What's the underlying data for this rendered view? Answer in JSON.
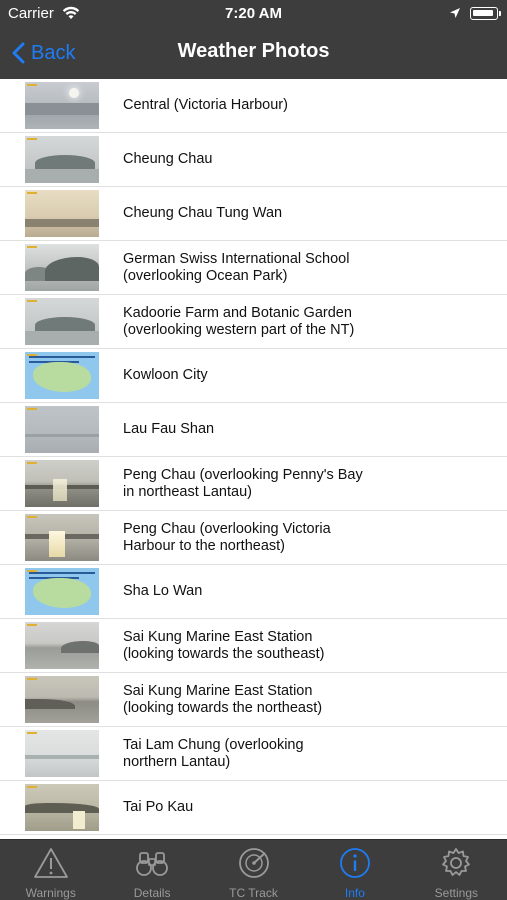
{
  "status_bar": {
    "carrier": "Carrier",
    "time": "7:20 AM"
  },
  "nav": {
    "back_label": "Back",
    "title": "Weather Photos"
  },
  "colors": {
    "bar_background": "#3d3d3d",
    "accent_blue": "#1e7cf5",
    "tab_inactive": "#9a9a9a"
  },
  "locations": [
    {
      "line1": "Central (Victoria Harbour)",
      "line2": "",
      "thumb": "harbour"
    },
    {
      "line1": "Cheung Chau",
      "line2": "",
      "thumb": "hills"
    },
    {
      "line1": "Cheung Chau Tung Wan",
      "line2": "",
      "thumb": "warm"
    },
    {
      "line1": "German Swiss International School",
      "line2": "(overlooking Ocean Park)",
      "thumb": "dark"
    },
    {
      "line1": "Kadoorie Farm and Botanic Garden",
      "line2": "(overlooking western part of the NT)",
      "thumb": "hills"
    },
    {
      "line1": "Kowloon City",
      "line2": "",
      "thumb": "map"
    },
    {
      "line1": "Lau Fau Shan",
      "line2": "",
      "thumb": "grey"
    },
    {
      "line1": "Peng Chau (overlooking Penny's Bay",
      "line2": "in northeast Lantau)",
      "thumb": "sunset"
    },
    {
      "line1": "Peng Chau (overlooking Victoria",
      "line2": "Harbour to the northeast)",
      "thumb": "dawn"
    },
    {
      "line1": "Sha Lo Wan",
      "line2": "",
      "thumb": "map"
    },
    {
      "line1": "Sai Kung Marine East Station",
      "line2": "(looking towards the southeast)",
      "thumb": "sea"
    },
    {
      "line1": "Sai Kung Marine East Station",
      "line2": "(looking towards the northeast)",
      "thumb": "sea2"
    },
    {
      "line1": "Tai Lam Chung (overlooking",
      "line2": "northern Lantau)",
      "thumb": "lam"
    },
    {
      "line1": "Tai Po Kau",
      "line2": "",
      "thumb": "taipo"
    }
  ],
  "tabs": [
    {
      "label": "Warnings",
      "icon": "warning-triangle-icon",
      "active": false
    },
    {
      "label": "Details",
      "icon": "binoculars-icon",
      "active": false
    },
    {
      "label": "TC Track",
      "icon": "radar-icon",
      "active": false
    },
    {
      "label": "Info",
      "icon": "info-icon",
      "active": true
    },
    {
      "label": "Settings",
      "icon": "gear-icon",
      "active": false
    }
  ]
}
